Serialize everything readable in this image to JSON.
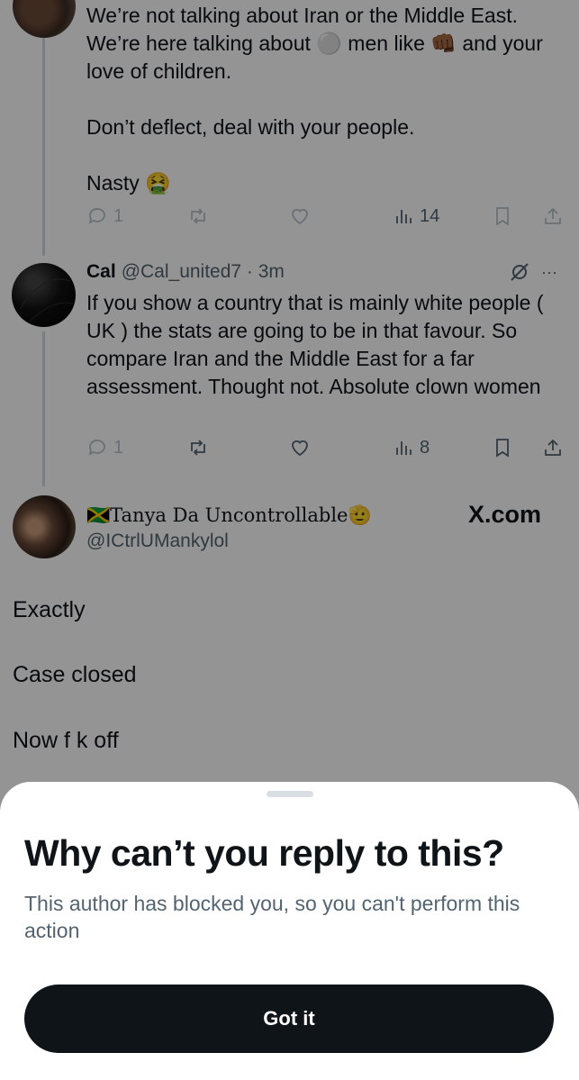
{
  "tweet1": {
    "paragraphs": [
      "We’re not talking about Iran or the Middle East. We’re here talking about ⚪ men like 👊🏾 and your love of children.",
      "Don’t deflect, deal with your people.",
      "Nasty 🤮"
    ],
    "replies": "1",
    "views": "14"
  },
  "tweet2": {
    "name": "Cal",
    "handle": "@Cal_united7 · 3m",
    "more": "···",
    "text": "If you show a country that is mainly white people ( UK ) the stats are going to be in that favour. So compare Iran and the Middle East for a far assessment. Thought not. Absolute clown women",
    "replies": "1",
    "views": "8"
  },
  "tweet3": {
    "display_name": "🇯🇲Tanya Da Uncontrollable🫡",
    "handle": "@ICtrlUMankylol",
    "watermark": "X.com",
    "lines": [
      "Exactly",
      "Case closed",
      "Now f k off"
    ]
  },
  "sheet": {
    "title": "Why can’t you reply to this?",
    "description": "This author has blocked you, so you can't perform this action",
    "button": "Got it"
  }
}
